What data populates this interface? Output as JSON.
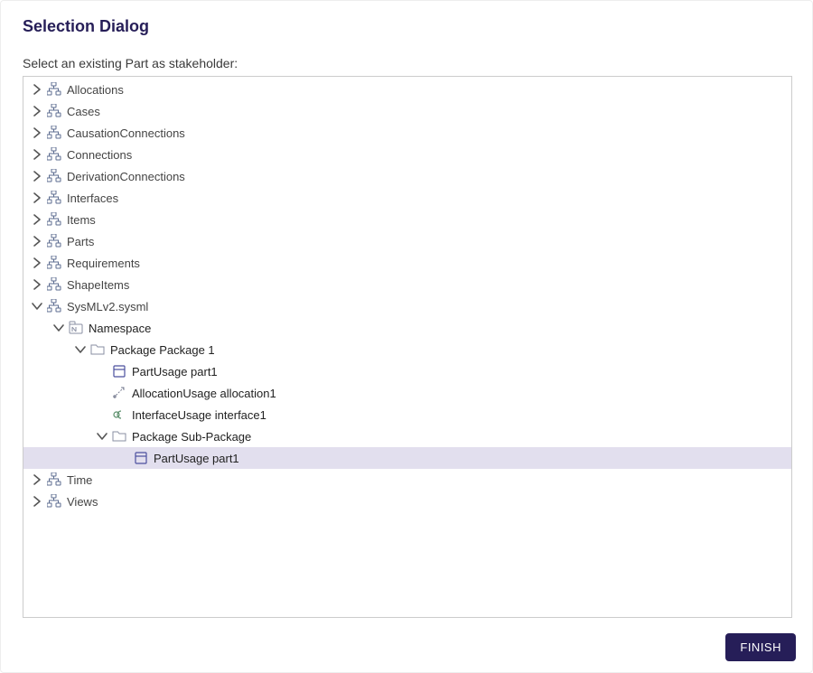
{
  "dialog": {
    "title": "Selection Dialog",
    "instruction": "Select an existing Part as stakeholder:",
    "finish_label": "FINISH"
  },
  "tree": {
    "top": [
      "Allocations",
      "Cases",
      "CausationConnections",
      "Connections",
      "DerivationConnections",
      "Interfaces",
      "Items",
      "Parts",
      "Requirements",
      "ShapeItems"
    ],
    "model_label": "SysMLv2.sysml",
    "namespace_label": "Namespace",
    "package1_label": "Package Package 1",
    "part1_label": "PartUsage part1",
    "allocation_label": "AllocationUsage allocation1",
    "interface_label": "InterfaceUsage interface1",
    "subpackage_label": "Package Sub-Package",
    "sub_part_label": "PartUsage part1",
    "bottom": [
      "Time",
      "Views"
    ]
  }
}
